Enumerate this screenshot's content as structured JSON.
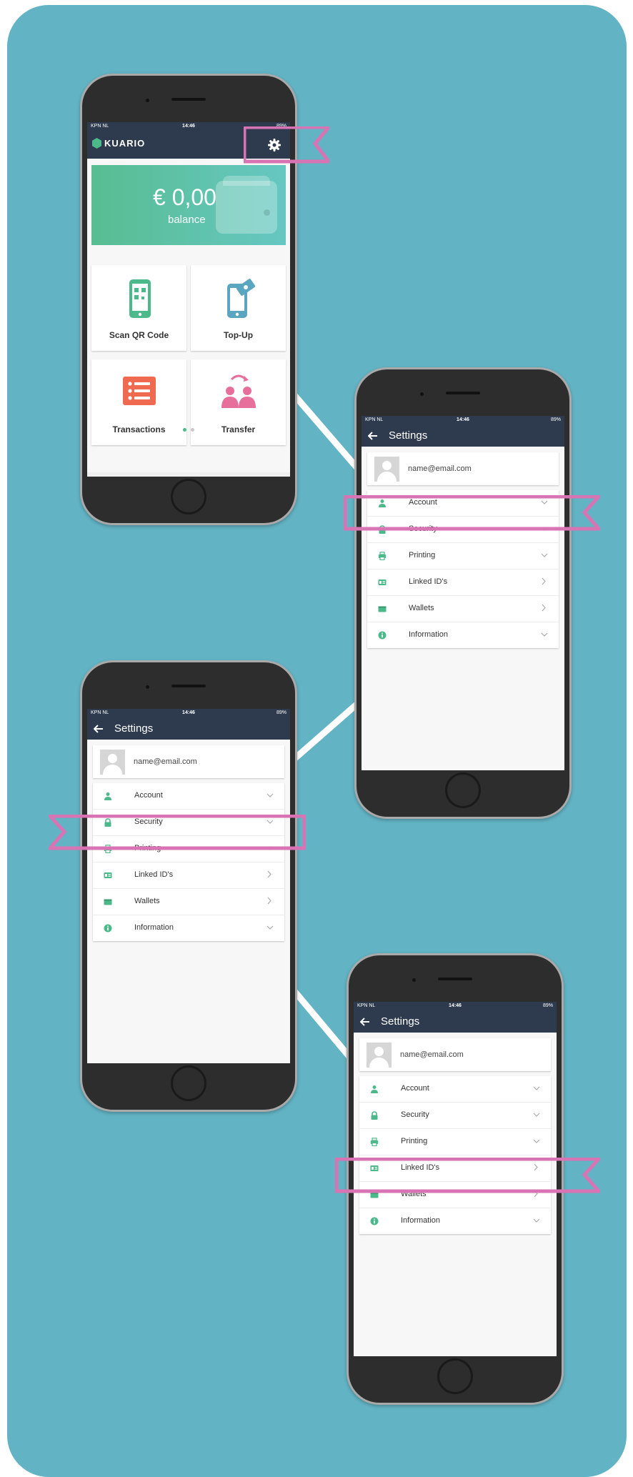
{
  "colors": {
    "background": "#62b3c4",
    "appbar": "#2e3b4e",
    "highlight": "#d874b3",
    "accent_green": "#4cb98a",
    "tile_blue": "#5aa6c0",
    "tile_orange": "#ef6a4e",
    "tile_pink": "#e76f9b"
  },
  "status_bar": {
    "carrier": "KPN NL",
    "time": "14:46",
    "battery": "89%"
  },
  "home": {
    "brand": "KUARIO",
    "balance_amount": "€ 0,00",
    "balance_label": "balance",
    "tiles": [
      {
        "label": "Scan QR Code",
        "icon": "qr-phone-icon"
      },
      {
        "label": "Top-Up",
        "icon": "topup-phone-icon"
      },
      {
        "label": "Transactions",
        "icon": "list-icon"
      },
      {
        "label": "Transfer",
        "icon": "transfer-people-icon"
      }
    ],
    "page_indicator": {
      "count": 2,
      "active": 1
    }
  },
  "settings": {
    "title": "Settings",
    "email": "name@email.com",
    "items": [
      {
        "label": "Account",
        "icon": "person-icon",
        "chevron": "down"
      },
      {
        "label": "Security",
        "icon": "lock-icon",
        "chevron": "down"
      },
      {
        "label": "Printing",
        "icon": "printer-icon",
        "chevron": "down"
      },
      {
        "label": "Linked ID's",
        "icon": "id-card-icon",
        "chevron": "right"
      },
      {
        "label": "Wallets",
        "icon": "wallet-icon",
        "chevron": "right"
      },
      {
        "label": "Information",
        "icon": "info-icon",
        "chevron": "down"
      }
    ]
  }
}
